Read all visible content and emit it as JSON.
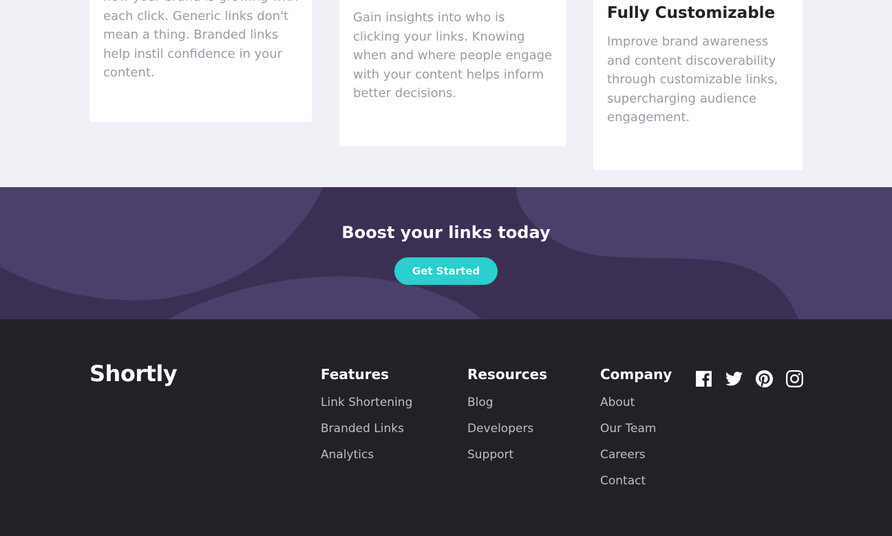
{
  "stats": {
    "cards": [
      {
        "text": "how your brand is growing with each click. Generic links don't mean a thing. Branded links help instil confidence in your content."
      },
      {
        "text": "Gain insights into who is clicking your links. Knowing when and where people engage with your content helps inform better decisions."
      },
      {
        "title": "Fully Customizable",
        "text": "Improve brand awareness and content discoverability through customizable links, supercharging audience engagement."
      }
    ]
  },
  "boost": {
    "title": "Boost your links today",
    "cta_label": "Get Started"
  },
  "footer": {
    "logo": "Shortly",
    "columns": [
      {
        "title": "Features",
        "links": [
          "Link Shortening",
          "Branded Links",
          "Analytics"
        ]
      },
      {
        "title": "Resources",
        "links": [
          "Blog",
          "Developers",
          "Support"
        ]
      },
      {
        "title": "Company",
        "links": [
          "About",
          "Our Team",
          "Careers",
          "Contact"
        ]
      }
    ],
    "social": [
      "facebook-icon",
      "twitter-icon",
      "pinterest-icon",
      "instagram-icon"
    ]
  },
  "colors": {
    "accent": "#2acfcf",
    "dark_violet": "#3b3054",
    "footer_bg": "#232127",
    "gray_text": "#9e9aa7"
  }
}
